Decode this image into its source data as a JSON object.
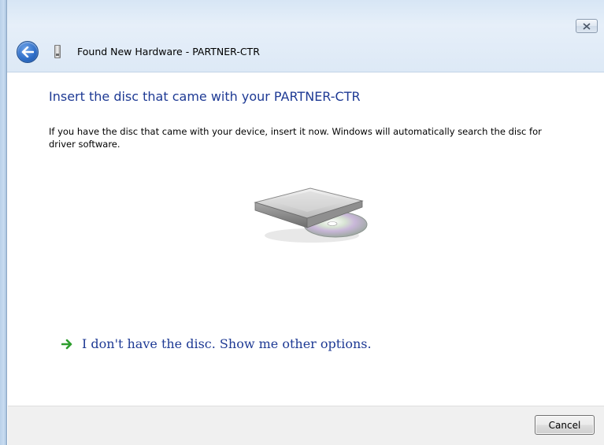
{
  "window": {
    "title": "Found New Hardware - PARTNER-CTR"
  },
  "content": {
    "heading": "Insert the disc that came with your PARTNER-CTR",
    "description": "If you have the disc that came with your device, insert it now.  Windows will automatically search the disc for driver software.",
    "option_link": "I don't have the disc.  Show me other options."
  },
  "footer": {
    "cancel_label": "Cancel"
  },
  "icons": {
    "back": "back-arrow-icon",
    "device": "usb-device-icon",
    "disc": "disc-drive-icon",
    "option": "green-arrow-icon",
    "close": "close-icon"
  },
  "colors": {
    "heading": "#1e3a94",
    "link": "#1e3a94",
    "link_arrow": "#2e9e2e",
    "footer_bg": "#f0f0f0"
  }
}
